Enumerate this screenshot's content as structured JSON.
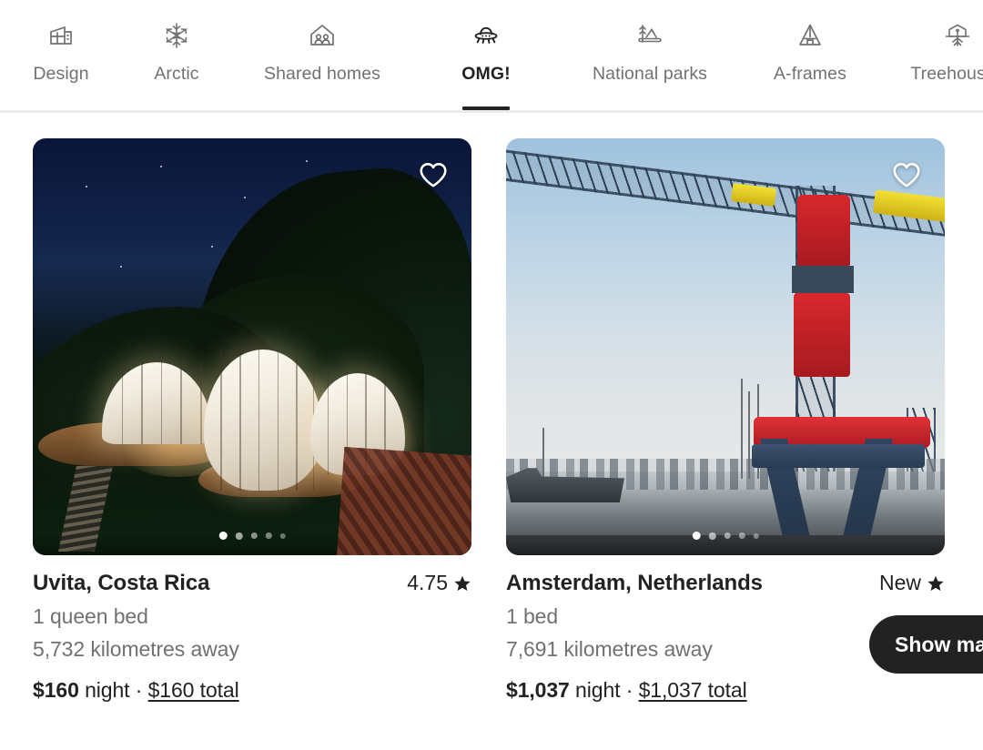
{
  "nav": {
    "categories": [
      {
        "label": "Design",
        "icon": "design-house-icon",
        "active": false
      },
      {
        "label": "Arctic",
        "icon": "snowflake-icon",
        "active": false
      },
      {
        "label": "Shared homes",
        "icon": "shared-homes-icon",
        "active": false
      },
      {
        "label": "OMG!",
        "icon": "ufo-icon",
        "active": true
      },
      {
        "label": "National parks",
        "icon": "national-parks-icon",
        "active": false
      },
      {
        "label": "A-frames",
        "icon": "a-frame-icon",
        "active": false
      },
      {
        "label": "Treehouses",
        "icon": "treehouse-icon",
        "active": false
      }
    ]
  },
  "listings": [
    {
      "title": "Uvita, Costa Rica",
      "rating": "4.75",
      "rating_icon": "star-icon",
      "beds": "1 queen bed",
      "distance": "5,732 kilometres away",
      "price_amount": "$160",
      "price_unit": "night",
      "price_separator": "·",
      "price_total": "$160 total",
      "favorite_icon": "heart-outline-icon",
      "photo": "glamping-domes-at-night",
      "carousel": {
        "count": 5,
        "active_index": 0
      }
    },
    {
      "title": "Amsterdam, Netherlands",
      "rating": "New",
      "rating_icon": "star-icon",
      "beds": "1 bed",
      "distance": "7,691 kilometres away",
      "price_amount": "$1,037",
      "price_unit": "night",
      "price_separator": "·",
      "price_total": "$1,037 total",
      "favorite_icon": "heart-outline-icon",
      "photo": "harbour-crane",
      "carousel": {
        "count": 5,
        "active_index": 0
      }
    }
  ],
  "show_map_button": {
    "label": "Show map"
  },
  "colors": {
    "text_primary": "#222222",
    "text_secondary": "#717171",
    "divider": "#ebebeb",
    "button_bg": "#222222",
    "button_text": "#ffffff"
  }
}
